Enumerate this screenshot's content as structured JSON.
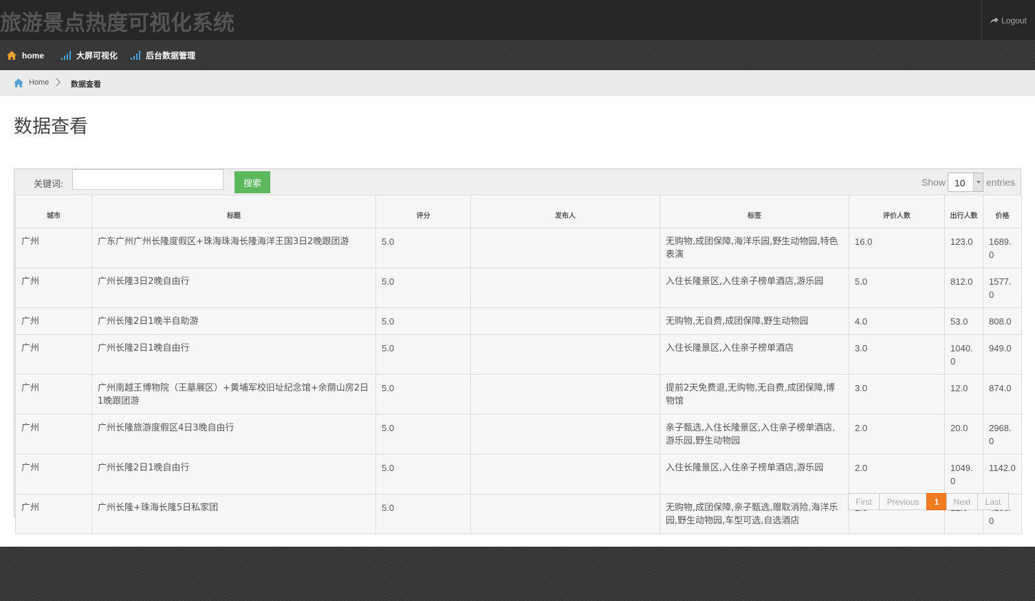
{
  "app": {
    "title": "旅游景点热度可视化系统",
    "logout_label": "Logout"
  },
  "nav": {
    "items": [
      {
        "label": "home",
        "icon": "home-icon"
      },
      {
        "label": "大屏可视化",
        "icon": "signal-bars-icon"
      },
      {
        "label": "后台数据管理",
        "icon": "signal-bars-icon"
      }
    ]
  },
  "breadcrumb": {
    "home": "Home",
    "current": "数据查看"
  },
  "page": {
    "title": "数据查看"
  },
  "filter": {
    "keyword_label": "关键词:",
    "keyword_value": "",
    "search_label": "搜索",
    "show_label": "Show",
    "show_value": "10",
    "entries_label": "entries"
  },
  "table": {
    "headers": [
      "城市",
      "标题",
      "评分",
      "发布人",
      "标签",
      "评价人数",
      "出行人数",
      "价格"
    ],
    "rows": [
      [
        "广州",
        "广东广州广州长隆度假区+珠海珠海长隆海洋王国3日2晚跟团游",
        "5.0",
        "",
        "无购物,成团保障,海洋乐园,野生动物园,特色表演",
        "16.0",
        "123.0",
        "1689.0"
      ],
      [
        "广州",
        "广州长隆3日2晚自由行",
        "5.0",
        "",
        "入住长隆景区,入住亲子榜单酒店,游乐园",
        "5.0",
        "812.0",
        "1577.0"
      ],
      [
        "广州",
        "广州长隆2日1晚半自助游",
        "5.0",
        "",
        "无购物,无自费,成团保障,野生动物园",
        "4.0",
        "53.0",
        "808.0"
      ],
      [
        "广州",
        "广州长隆2日1晚自由行",
        "5.0",
        "",
        "入住长隆景区,入住亲子榜单酒店",
        "3.0",
        "1040.0",
        "949.0"
      ],
      [
        "广州",
        "广州南越王博物院（王墓展区）+黄埔军校旧址纪念馆+余荫山房2日1晚跟团游",
        "5.0",
        "",
        "提前2天免费退,无购物,无自费,成团保障,博物馆",
        "3.0",
        "12.0",
        "874.0"
      ],
      [
        "广州",
        "广州长隆旅游度假区4日3晚自由行",
        "5.0",
        "",
        "亲子甄选,入住长隆景区,入住亲子榜单酒店,游乐园,野生动物园",
        "2.0",
        "20.0",
        "2968.0"
      ],
      [
        "广州",
        "广州长隆2日1晚自由行",
        "5.0",
        "",
        "入住长隆景区,入住亲子榜单酒店,游乐园",
        "2.0",
        "1049.0",
        "1142.0"
      ],
      [
        "广州",
        "广州长隆+珠海长隆5日私家团",
        "5.0",
        "",
        "无购物,成团保障,亲子甄选,赠取消险,海洋乐园,野生动物园,车型可选,自选酒店",
        "2.0",
        "22.0",
        "4100.0"
      ]
    ]
  },
  "pager": {
    "first": "First",
    "previous": "Previous",
    "current": "1",
    "next": "Next",
    "last": "Last"
  },
  "colors": {
    "accent": "#f07c1f",
    "search_button": "#5cb85c",
    "header_bg": "#262626"
  }
}
